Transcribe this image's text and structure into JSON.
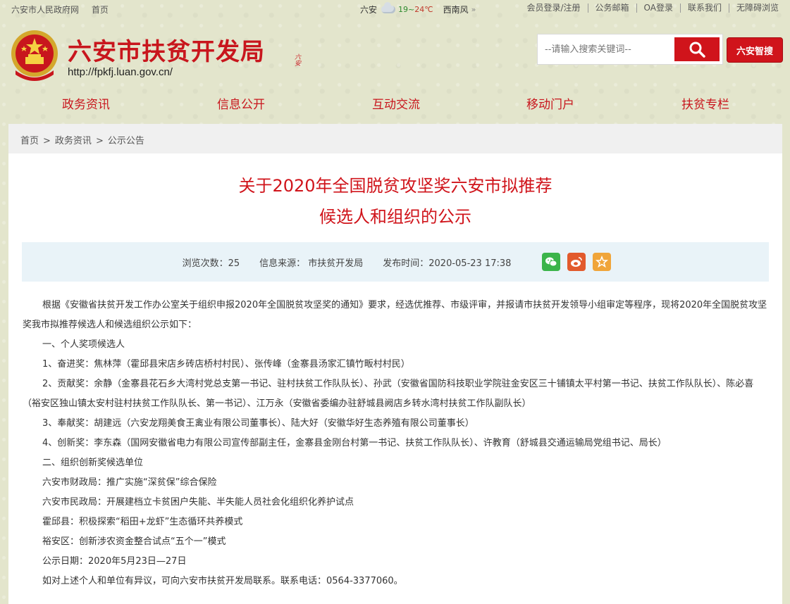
{
  "topbar": {
    "left": [
      "六安市人民政府网",
      "首页"
    ],
    "weather": {
      "city": "六安",
      "low": "19~",
      "high": "24℃",
      "wind": "西南风"
    },
    "right": [
      "会员登录/注册",
      "公务邮箱",
      "OA登录",
      "联系我们",
      "无障碍浏览"
    ]
  },
  "header": {
    "title": "六安市扶贫开发局",
    "url": "http://fpkfj.luan.gov.cn/",
    "search_placeholder": "--请输入搜索关键词--",
    "smart_search": "六安智搜"
  },
  "nav": [
    "政务资讯",
    "信息公开",
    "互动交流",
    "移动门户",
    "扶贫专栏"
  ],
  "breadcrumb": [
    "首页",
    "政务资讯",
    "公示公告"
  ],
  "article": {
    "title_line1": "关于2020年全国脱贫攻坚奖六安市拟推荐",
    "title_line2": "候选人和组织的公示",
    "views": "浏览次数：25",
    "source": "信息来源： 市扶贫开发局",
    "time": "发布时间：2020-05-23 17:38",
    "paragraphs": [
      "根据《安徽省扶贫开发工作办公室关于组织申报2020年全国脱贫攻坚奖的通知》要求，经选优推荐、市级评审，并报请市扶贫开发领导小组审定等程序，现将2020年全国脱贫攻坚奖我市拟推荐候选人和候选组织公示如下：",
      "一、个人奖项候选人",
      "1、奋进奖：焦林萍（霍邱县宋店乡砖店桥村村民）、张传峰（金寨县汤家汇镇竹畈村村民）",
      "2、贡献奖：余静（金寨县花石乡大湾村党总支第一书记、驻村扶贫工作队队长）、孙武（安徽省国防科技职业学院驻金安区三十铺镇太平村第一书记、扶贫工作队队长）、陈必喜（裕安区独山镇太安村驻村扶贫工作队队长、第一书记）、江万永（安徽省委编办驻舒城县阙店乡转水湾村扶贫工作队副队长）",
      "3、奉献奖：胡建远（六安龙翔美食王禽业有限公司董事长）、陆大好（安徽华好生态养殖有限公司董事长）",
      "4、创新奖：李东森（国网安徽省电力有限公司宣传部副主任，金寨县金刚台村第一书记、扶贫工作队队长）、许教育（舒城县交通运输局党组书记、局长）",
      "二、组织创新奖候选单位",
      "六安市财政局：推广实施“深贫保”综合保险",
      "六安市民政局：开展建档立卡贫困户失能、半失能人员社会化组织化养护试点",
      "霍邱县：积极探索“稻田+龙虾”生态循环共养模式",
      "裕安区：创新涉农资金整合试点“五个一”模式",
      "公示日期：2020年5月23日—27日",
      "如对上述个人和单位有异议，可向六安市扶贫开发局联系。联系电话：0564-3377060。"
    ]
  }
}
